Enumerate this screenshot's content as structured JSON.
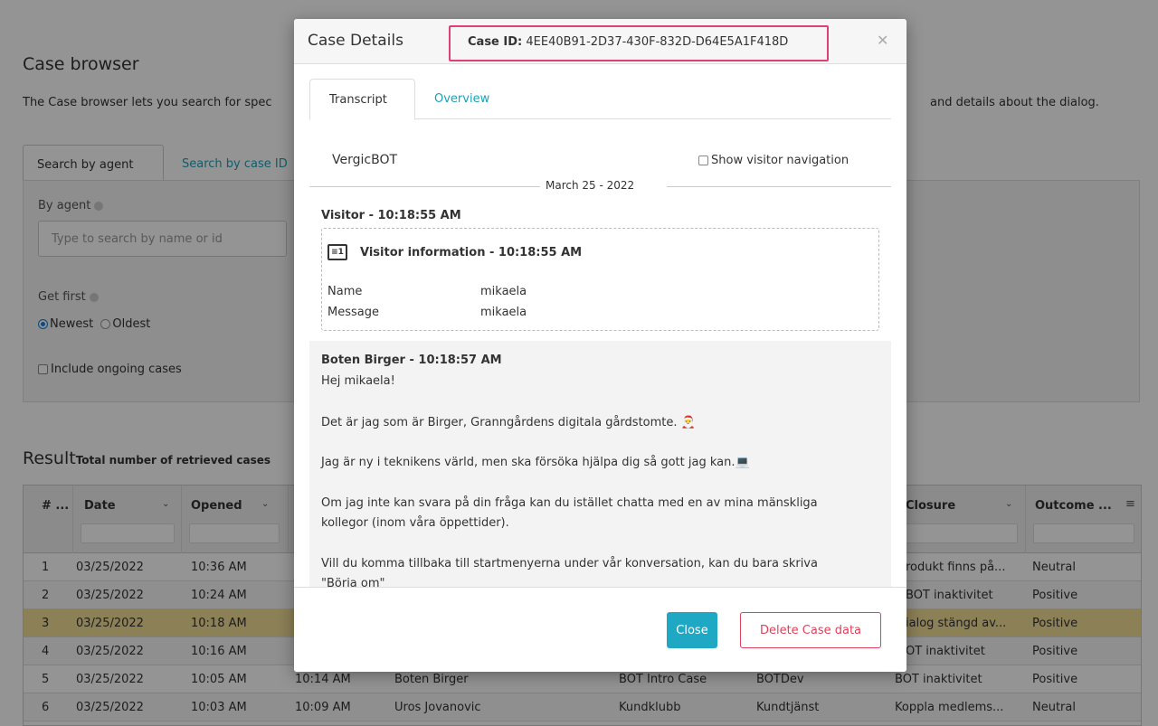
{
  "page": {
    "title": "Case browser",
    "description": "The Case browser lets you search for spec",
    "description_right": "and details about the dialog.",
    "tabs": [
      "Search by agent",
      "Search by case ID"
    ],
    "search": {
      "by_agent_label": "By agent",
      "agent_placeholder": "Type to search by name or id",
      "get_first_label": "Get first",
      "radio_newest": "Newest",
      "radio_oldest": "Oldest",
      "include_ongoing": "Include ongoing cases"
    },
    "result": {
      "title": "Result",
      "subtitle": "Total number of retrieved cases"
    },
    "grid": {
      "headers": [
        "# ...",
        "Date",
        "Opened",
        "Closure",
        "Outcome ..."
      ],
      "rows": [
        {
          "num": "1",
          "date": "03/25/2022",
          "opened": "10:36 AM",
          "closed": "",
          "agent": "",
          "case_type": "",
          "queue": "",
          "closure": "rodukt finns på...",
          "outcome": "Neutral"
        },
        {
          "num": "2",
          "date": "03/25/2022",
          "opened": "10:24 AM",
          "closed": "",
          "agent": "",
          "case_type": "",
          "queue": "",
          "closure": "BOT inaktivitet",
          "outcome": "Positive"
        },
        {
          "num": "3",
          "date": "03/25/2022",
          "opened": "10:18 AM",
          "closed": "",
          "agent": "",
          "case_type": "",
          "queue": "",
          "closure": "ialog stängd av...",
          "outcome": "Positive"
        },
        {
          "num": "4",
          "date": "03/25/2022",
          "opened": "10:16 AM",
          "closed": "",
          "agent": "",
          "case_type": "",
          "queue": "",
          "closure": "OT inaktivitet",
          "outcome": "Positive"
        },
        {
          "num": "5",
          "date": "03/25/2022",
          "opened": "10:05 AM",
          "closed": "10:14 AM",
          "agent": "Boten Birger",
          "case_type": "BOT Intro Case",
          "queue": "BOTDev",
          "closure": "BOT inaktivitet",
          "outcome": "Positive"
        },
        {
          "num": "6",
          "date": "03/25/2022",
          "opened": "10:03 AM",
          "closed": "10:09 AM",
          "agent": "Uros Jovanovic",
          "case_type": "Kundklubb",
          "queue": "Kundtjänst",
          "closure": "Koppla medlems...",
          "outcome": "Neutral"
        }
      ]
    }
  },
  "modal": {
    "title": "Case Details",
    "case_id_label": "Case ID:",
    "case_id_value": "4EE40B91-2D37-430F-832D-D64E5A1F418D",
    "tabs": [
      "Transcript",
      "Overview"
    ],
    "bot_name": "VergicBOT",
    "show_visitor_navigation": "Show visitor navigation",
    "date_divider": "March 25 - 2022",
    "visitor_header": "Visitor - 10:18:55 AM",
    "visitor_info": {
      "title": "Visitor information - 10:18:55 AM",
      "icon_text": "≡1",
      "fields": [
        {
          "key": "Name",
          "value": "mikaela"
        },
        {
          "key": "Message",
          "value": "mikaela"
        }
      ]
    },
    "bot_message": {
      "header": "Boten Birger - 10:18:57 AM",
      "lines": [
        "Hej mikaela!",
        "Det är jag som är Birger, Granngårdens digitala gårdstomte. 🎅",
        "Jag är ny i teknikens värld, men ska försöka hjälpa dig så gott jag kan.💻",
        "Om jag inte kan svara på din fråga kan du istället chatta med en av mina mänskliga",
        "kollegor (inom våra öppettider).",
        "Vill du komma tillbaka till startmenyerna under vår konversation, kan du bara skriva",
        "\"Börja om\""
      ]
    },
    "buttons": {
      "close": "Close",
      "delete": "Delete Case data"
    },
    "icons": {
      "close": "close-icon",
      "visitor_info": "id-card-icon"
    },
    "colors": {
      "accent": "#1fa8c4",
      "danger": "#e0405a",
      "highlight_border": "#e0407a",
      "selected_row": "#f1dc97"
    }
  }
}
